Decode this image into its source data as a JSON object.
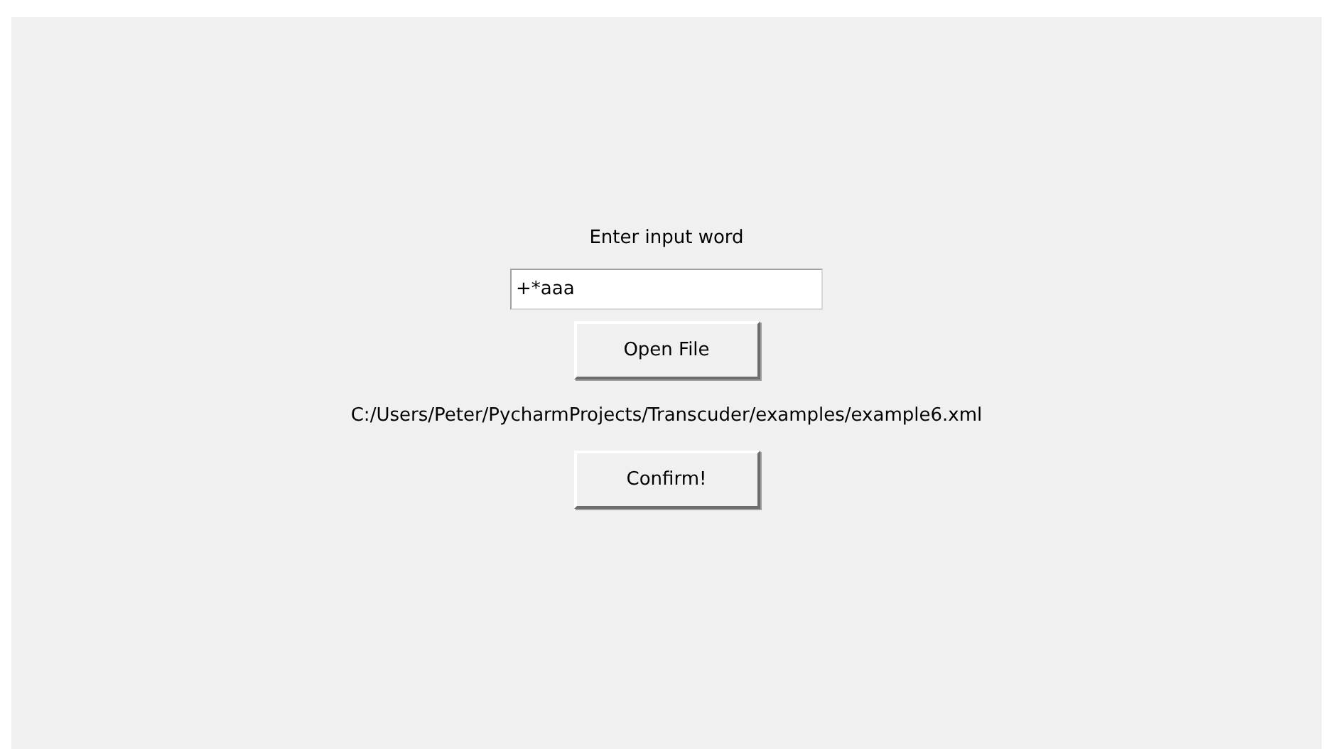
{
  "prompt_label": "Enter input word",
  "word_field": {
    "value": "+*aaa"
  },
  "open_button": "Open File",
  "file_path": "C:/Users/Peter/PycharmProjects/Transcuder/examples/example6.xml",
  "confirm_button": "Confirm!"
}
